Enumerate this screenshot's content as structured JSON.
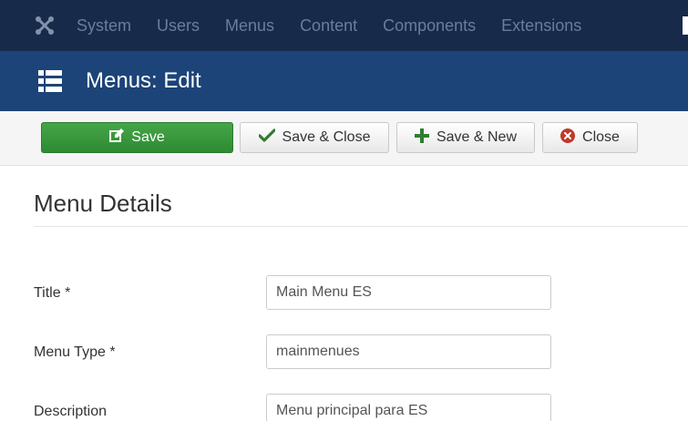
{
  "topnav": {
    "logo_icon": "joomla-logo-icon",
    "items": [
      "System",
      "Users",
      "Menus",
      "Content",
      "Components",
      "Extensions"
    ]
  },
  "header": {
    "icon": "list-icon",
    "title": "Menus: Edit"
  },
  "toolbar": {
    "save_label": "Save",
    "save_close_label": "Save & Close",
    "save_new_label": "Save & New",
    "close_label": "Close"
  },
  "section": {
    "title": "Menu Details"
  },
  "form": {
    "title_label": "Title *",
    "title_value": "Main Menu ES",
    "menu_type_label": "Menu Type *",
    "menu_type_value": "mainmenues",
    "description_label": "Description",
    "description_value": "Menu principal para ES"
  },
  "colors": {
    "topnav_bg": "#172a4a",
    "header_bg": "#1c4478",
    "save_green": "#3a9a3e",
    "close_red": "#c0392b"
  }
}
